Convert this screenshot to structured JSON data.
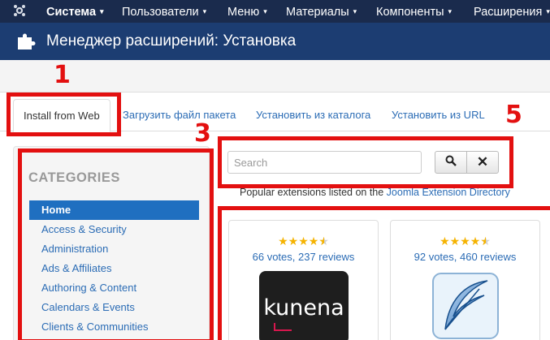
{
  "navbar": {
    "items": [
      {
        "label": "Система",
        "caret": "▾"
      },
      {
        "label": "Пользователи",
        "caret": "▾"
      },
      {
        "label": "Меню",
        "caret": "▾"
      },
      {
        "label": "Материалы",
        "caret": "▾"
      },
      {
        "label": "Компоненты",
        "caret": "▾"
      },
      {
        "label": "Расширения",
        "caret": "▾"
      }
    ]
  },
  "header": {
    "title": "Менеджер расширений: Установка",
    "icon": "puzzle-icon"
  },
  "tabs": [
    {
      "label": "Install from Web",
      "active": true
    },
    {
      "label": "Загрузить файл пакета",
      "active": false
    },
    {
      "label": "Установить из каталога",
      "active": false
    },
    {
      "label": "Установить из URL",
      "active": false
    }
  ],
  "categories": {
    "title": "CATEGORIES",
    "items": [
      {
        "label": "Home",
        "active": true
      },
      {
        "label": "Access & Security"
      },
      {
        "label": "Administration"
      },
      {
        "label": "Ads & Affiliates"
      },
      {
        "label": "Authoring & Content"
      },
      {
        "label": "Calendars & Events"
      },
      {
        "label": "Clients & Communities"
      }
    ]
  },
  "search": {
    "placeholder": "Search",
    "search_icon": "search-icon",
    "clear_label": "✕"
  },
  "popular": {
    "text": "Popular extensions listed on the ",
    "link": "Joomla Extension Directory"
  },
  "cards": [
    {
      "rating": 4.5,
      "votes": "66 votes, 237 reviews",
      "logo_text": "kunena"
    },
    {
      "rating": 4.5,
      "votes": "92 votes, 460 reviews",
      "logo": "feather-icon"
    }
  ],
  "annotations": {
    "numbers": [
      "1",
      "3",
      "5"
    ],
    "color": "#e31010"
  },
  "colors": {
    "navbar": "#1a2b4d",
    "header": "#1c3d72",
    "accent": "#2b6cb5",
    "active_item": "#1f6fc0",
    "star": "#f5b301"
  }
}
